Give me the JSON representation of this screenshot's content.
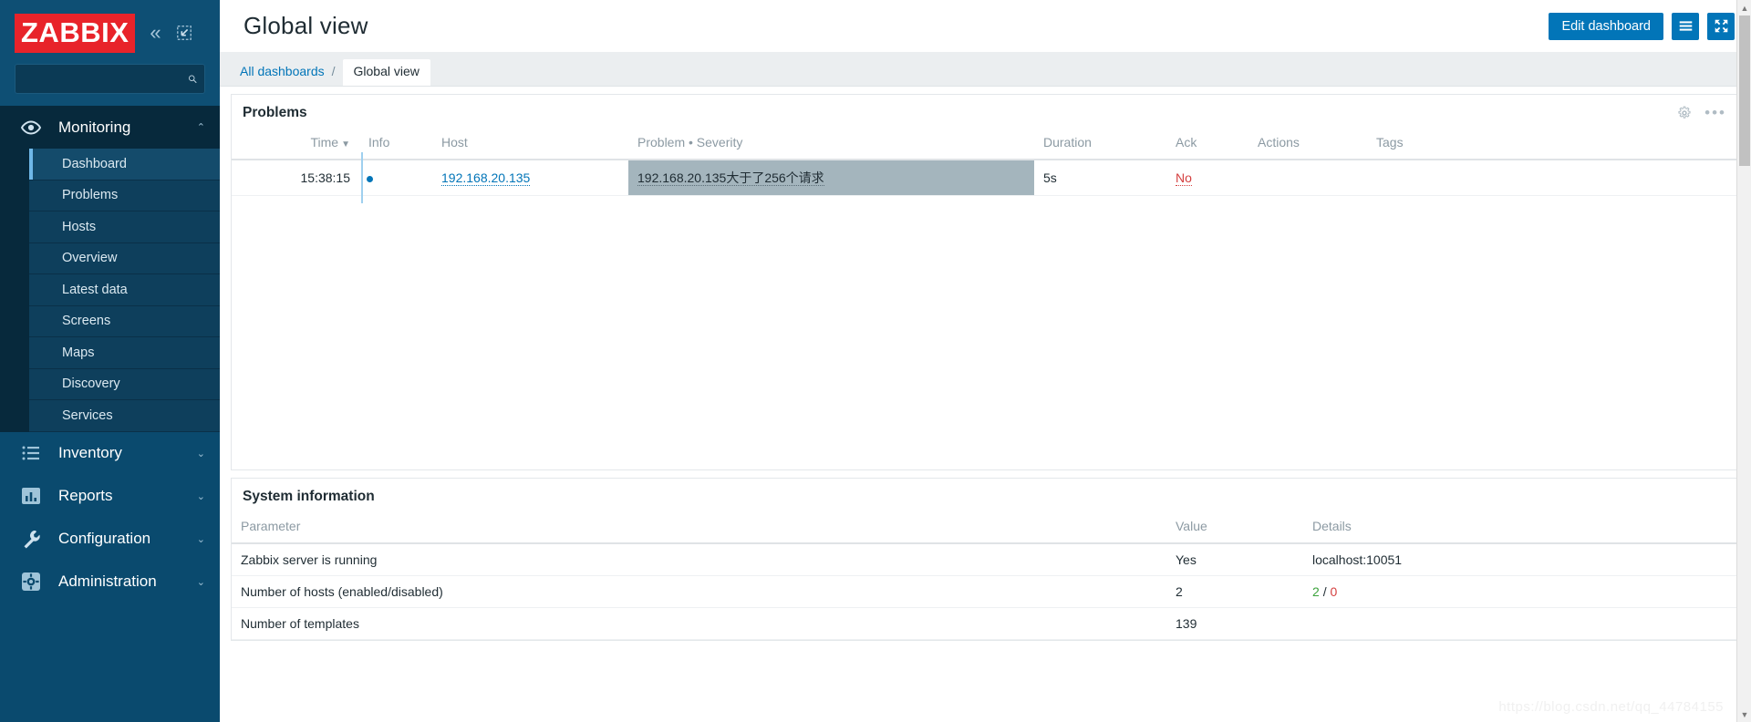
{
  "brand": {
    "logo_text": "ZABBIX"
  },
  "sidebar": {
    "search_placeholder": "",
    "search_value": "",
    "collapse_label": "«",
    "groups": [
      {
        "label": "Monitoring",
        "icon": "eye-icon",
        "expanded": true,
        "chevron": "⌃",
        "items": [
          {
            "label": "Dashboard",
            "current": true
          },
          {
            "label": "Problems",
            "current": false
          },
          {
            "label": "Hosts",
            "current": false
          },
          {
            "label": "Overview",
            "current": false
          },
          {
            "label": "Latest data",
            "current": false
          },
          {
            "label": "Screens",
            "current": false
          },
          {
            "label": "Maps",
            "current": false
          },
          {
            "label": "Discovery",
            "current": false
          },
          {
            "label": "Services",
            "current": false
          }
        ]
      },
      {
        "label": "Inventory",
        "icon": "list-icon",
        "expanded": false,
        "chevron": "⌄",
        "items": []
      },
      {
        "label": "Reports",
        "icon": "bar-chart-icon",
        "expanded": false,
        "chevron": "⌄",
        "items": []
      },
      {
        "label": "Configuration",
        "icon": "wrench-icon",
        "expanded": false,
        "chevron": "⌄",
        "items": []
      },
      {
        "label": "Administration",
        "icon": "gear-icon",
        "expanded": false,
        "chevron": "⌄",
        "items": []
      }
    ]
  },
  "header": {
    "title": "Global view",
    "edit_button": "Edit dashboard",
    "menu_icon": "hamburger-icon",
    "fullscreen_icon": "expand-arrows-icon"
  },
  "breadcrumb": {
    "root": "All dashboards",
    "separator": "/",
    "current": "Global view"
  },
  "problems_widget": {
    "title": "Problems",
    "gear_icon": "gear-icon",
    "more_icon": "ellipsis-icon",
    "columns": [
      "Time",
      "Info",
      "Host",
      "Problem • Severity",
      "Duration",
      "Ack",
      "Actions",
      "Tags"
    ],
    "sort_caret": "▼",
    "rows": [
      {
        "time": "15:38:15",
        "info": "",
        "host": "192.168.20.135",
        "problem": "192.168.20.135大于了256个请求",
        "duration": "5s",
        "ack": "No",
        "actions": "",
        "tags": ""
      }
    ]
  },
  "system_info_widget": {
    "title": "System information",
    "columns": [
      "Parameter",
      "Value",
      "Details"
    ],
    "rows": [
      {
        "parameter": "Zabbix server is running",
        "value": "Yes",
        "value_color": "green",
        "details": "localhost:10051",
        "details_color": "plain"
      },
      {
        "parameter": "Number of hosts (enabled/disabled)",
        "value": "2",
        "value_color": "plain",
        "details": "2 / 0",
        "details_color": "split"
      },
      {
        "parameter": "Number of templates",
        "value": "139",
        "value_color": "plain",
        "details": "",
        "details_color": "plain"
      }
    ],
    "details_split": {
      "left": "2",
      "sep": "/",
      "right": "0"
    }
  },
  "watermark": {
    "text": "https://blog.csdn.net/qq_44784155"
  },
  "colors": {
    "brand_red": "#e8232a",
    "sidebar_blue": "#0a4a6e",
    "accent_blue": "#0275b8",
    "status_green": "#3ca33c",
    "status_red": "#d43f3f",
    "severity_average": "#a4b5bd"
  }
}
